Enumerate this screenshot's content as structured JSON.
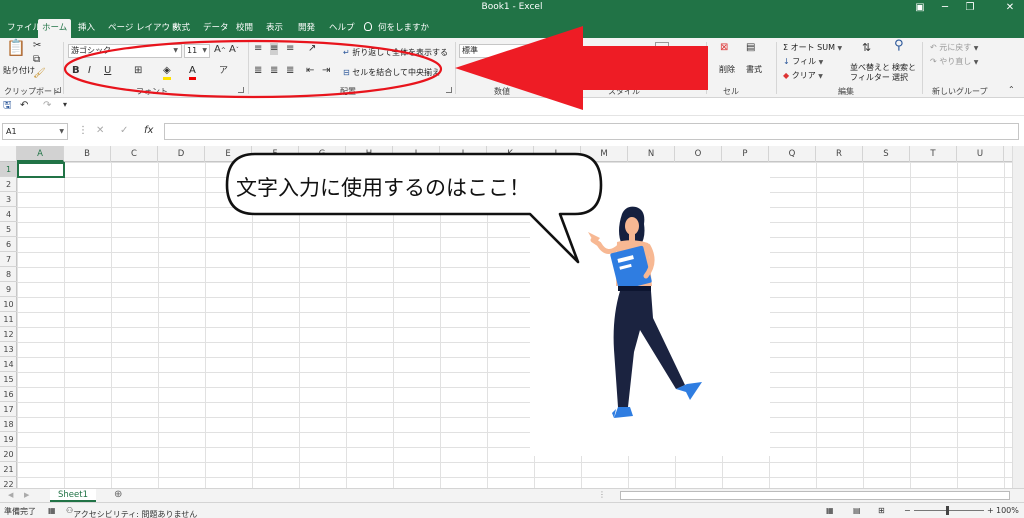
{
  "window": {
    "title": "Book1  -  Excel"
  },
  "tabs": [
    {
      "label": "ファイル",
      "active": false
    },
    {
      "label": "ホーム",
      "active": true
    },
    {
      "label": "挿入",
      "active": false
    },
    {
      "label": "ページ レイアウト",
      "active": false
    },
    {
      "label": "数式",
      "active": false
    },
    {
      "label": "データ",
      "active": false
    },
    {
      "label": "校閲",
      "active": false
    },
    {
      "label": "表示",
      "active": false
    },
    {
      "label": "開発",
      "active": false
    },
    {
      "label": "ヘルプ",
      "active": false
    }
  ],
  "tell_me": "何をしますか",
  "ribbon": {
    "clipboard": {
      "paste_label": "貼り付け",
      "group_label": "クリップボード"
    },
    "font": {
      "font_name": "游ゴシック",
      "font_size": "11",
      "group_label": "フォント",
      "bold": "B",
      "italic": "I",
      "underline": "U"
    },
    "alignment": {
      "wrap_text": "折り返して全体を表示する",
      "merge_center": "セルを結合して中央揃え",
      "group_label": "配置"
    },
    "number": {
      "format": "標準",
      "group_label": "数値"
    },
    "styles": {
      "group_label": "スタイル"
    },
    "cells": {
      "delete_label": "削除",
      "format_label": "書式",
      "group_label": "セル"
    },
    "editing": {
      "autosum": "オート SUM",
      "fill": "フィル",
      "clear": "クリア",
      "sort_filter_1": "並べ替えと",
      "sort_filter_2": "フィルター",
      "find_select_1": "検索と",
      "find_select_2": "選択",
      "group_label": "編集"
    },
    "new_group": {
      "undo": "元に戻す",
      "redo": "やり直し",
      "group_label": "新しいグループ"
    }
  },
  "formula_bar": {
    "name_box": "A1",
    "fx": "fx",
    "value": ""
  },
  "columns": [
    "A",
    "B",
    "C",
    "D",
    "E",
    "F",
    "G",
    "H",
    "I",
    "J",
    "K",
    "L",
    "M",
    "N",
    "O",
    "P",
    "Q",
    "R",
    "S",
    "T",
    "U"
  ],
  "rows": [
    "1",
    "2",
    "3",
    "4",
    "5",
    "6",
    "7",
    "8",
    "9",
    "10",
    "11",
    "12",
    "13",
    "14",
    "15",
    "16",
    "17",
    "18",
    "19",
    "20",
    "21",
    "22"
  ],
  "callout": {
    "text": "文字入力に使用するのはここ！",
    "arrow_color": "#ee1c25",
    "ellipse_color": "#e8141c"
  },
  "sheets": [
    "Sheet1"
  ],
  "status": {
    "ready": "準備完了",
    "accessibility": "アクセシビリティ: 問題ありません",
    "zoom": "100%"
  },
  "colors": {
    "accent": "#217346",
    "ribbon_bg": "#f3f3f3"
  }
}
